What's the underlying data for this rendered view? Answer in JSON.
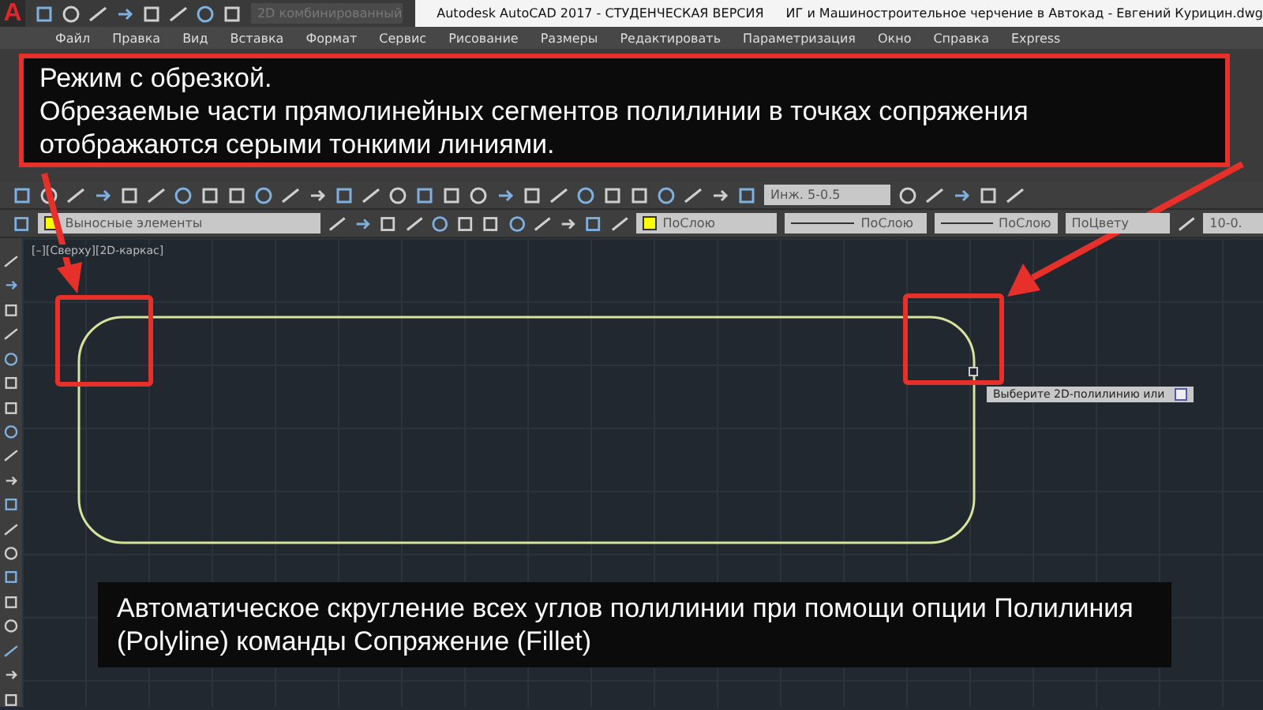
{
  "app": {
    "logo": "A",
    "workspace": "2D комбинированный",
    "product": "Autodesk AutoCAD 2017 - СТУДЕНЧЕСКАЯ ВЕРСИЯ",
    "document": "ИГ и Машиностроительное черчение в Автокад - Евгений Курицин.dwg"
  },
  "menu": [
    "Файл",
    "Правка",
    "Вид",
    "Вставка",
    "Формат",
    "Сервис",
    "Рисование",
    "Размеры",
    "Редактировать",
    "Параметризация",
    "Окно",
    "Справка",
    "Express"
  ],
  "callout": {
    "title": "Режим с обрезкой.",
    "text": "Обрезаемые части прямолинейных сегментов полилинии в точках сопряжения отображаются серыми тонкими линиями."
  },
  "toolbar": {
    "layer": "Выносные элементы",
    "dimstyle": "Инж. 5-0.5",
    "color_setting": "ПоСлою",
    "linetype": "ПоСлою",
    "lineweight": "ПоСлою",
    "plotstyle": "ПоЦвету",
    "mleaderstyle": "10-0."
  },
  "viewport": {
    "label": "[–][Сверху][2D-каркас]",
    "tooltip": "Выберите 2D-полилинию или"
  },
  "caption": "Автоматическое скругление всех углов полилинии при помощи опции Полилиния (Polyline) команды Сопряжение (Fillet)"
}
